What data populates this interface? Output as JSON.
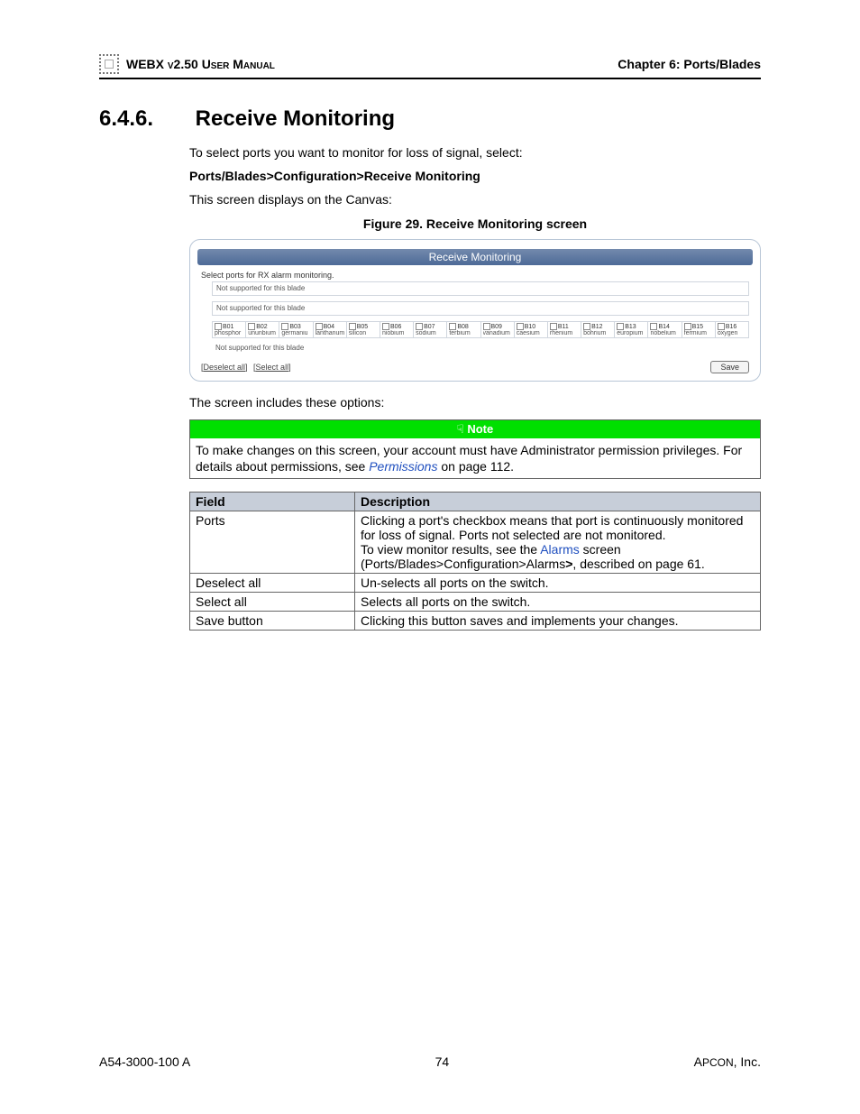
{
  "header": {
    "left": "WEBX v2.50 User Manual",
    "right": "Chapter 6: Ports/Blades"
  },
  "section": {
    "number": "6.4.6.",
    "title": "Receive Monitoring"
  },
  "body": {
    "intro": "To select ports you want to monitor for loss of signal, select:",
    "breadcrumb": "Ports/Blades>Configuration>Receive Monitoring",
    "canvas": "This screen displays on the Canvas:",
    "figure_title": "Figure 29. Receive Monitoring screen",
    "options_intro": "The screen includes these options:",
    "note": {
      "label": "Note",
      "text_a": "To make changes on this screen, your account must have Administrator permission privileges. For details about permissions, see ",
      "link": "Permissions",
      "text_b": " on page 112."
    }
  },
  "screenshot": {
    "title": "Receive Monitoring",
    "instruction": "Select ports for RX alarm monitoring.",
    "not_supported": "Not supported for this blade",
    "ports": [
      {
        "code": "B01",
        "name": "phosphor"
      },
      {
        "code": "B02",
        "name": "ununbium"
      },
      {
        "code": "B03",
        "name": "germaniu"
      },
      {
        "code": "B04",
        "name": "lanthanum"
      },
      {
        "code": "B05",
        "name": "silicon"
      },
      {
        "code": "B06",
        "name": "niobium"
      },
      {
        "code": "B07",
        "name": "sodium"
      },
      {
        "code": "B08",
        "name": "terbium"
      },
      {
        "code": "B09",
        "name": "vanadium"
      },
      {
        "code": "B10",
        "name": "caesium"
      },
      {
        "code": "B11",
        "name": "rhenium"
      },
      {
        "code": "B12",
        "name": "bohrium"
      },
      {
        "code": "B13",
        "name": "europium"
      },
      {
        "code": "B14",
        "name": "nobelium"
      },
      {
        "code": "B15",
        "name": "fermium"
      },
      {
        "code": "B16",
        "name": "oxygen"
      }
    ],
    "deselect": "[Deselect all]",
    "select": "[Select all]",
    "save": "Save"
  },
  "options_table": {
    "head_field": "Field",
    "head_desc": "Description",
    "rows": [
      {
        "field": "Ports",
        "desc_a": "Clicking a port's checkbox means that port is continuously monitored for loss of signal. Ports not selected are not monitored.",
        "desc_b_pre": "To view monitor results, see the ",
        "desc_b_link": "Alarms",
        "desc_b_post": " screen (Ports/Blades>Configuration>Alarms",
        "desc_b_bold": ">",
        "desc_b_tail": ", described on page 61."
      },
      {
        "field": "Deselect all",
        "desc_a": "Un-selects all ports on the switch."
      },
      {
        "field": "Select all",
        "desc_a": "Selects all ports on the switch."
      },
      {
        "field": "Save button",
        "desc_a": "Clicking this button saves and implements your changes."
      }
    ]
  },
  "footer": {
    "left": "A54-3000-100 A",
    "center": "74",
    "right_a": "A",
    "right_b": "PCON",
    "right_c": ", Inc."
  }
}
